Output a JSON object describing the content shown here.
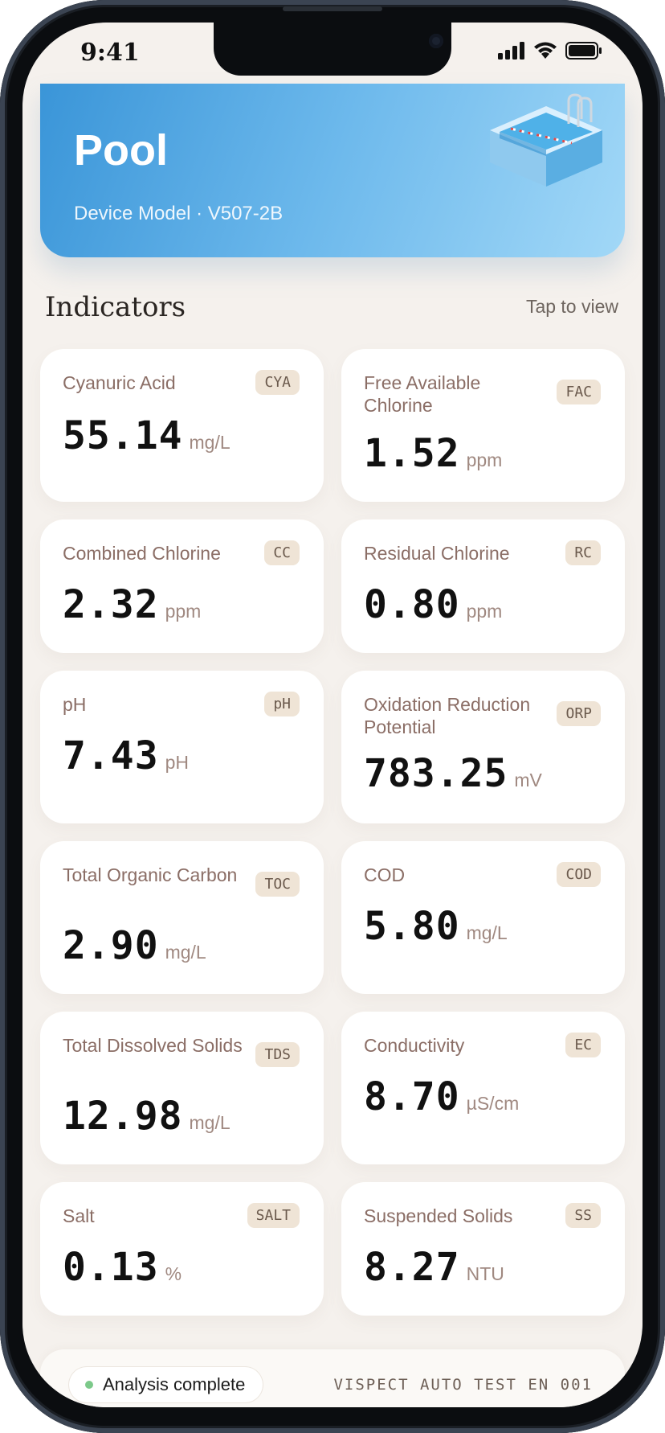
{
  "status_bar": {
    "time": "9:41"
  },
  "header": {
    "title": "Pool",
    "subtitle": "Device Model · V507-2B"
  },
  "section": {
    "title": "Indicators",
    "link": "Tap to view"
  },
  "indicators": [
    {
      "label": "Cyanuric Acid",
      "code": "CYA",
      "value": "55.14",
      "unit": "mg/L"
    },
    {
      "label": "Free Available Chlorine",
      "code": "FAC",
      "value": "1.52",
      "unit": "ppm"
    },
    {
      "label": "Combined Chlorine",
      "code": "CC",
      "value": "2.32",
      "unit": "ppm"
    },
    {
      "label": "Residual Chlorine",
      "code": "RC",
      "value": "0.80",
      "unit": "ppm"
    },
    {
      "label": "pH",
      "code": "pH",
      "value": "7.43",
      "unit": "pH"
    },
    {
      "label": "Oxidation Reduction Potential",
      "code": "ORP",
      "value": "783.25",
      "unit": "mV"
    },
    {
      "label": "Total Organic Carbon",
      "code": "TOC",
      "value": "2.90",
      "unit": "mg/L"
    },
    {
      "label": "COD",
      "code": "COD",
      "value": "5.80",
      "unit": "mg/L"
    },
    {
      "label": "Total Dissolved Solids",
      "code": "TDS",
      "value": "12.98",
      "unit": "mg/L"
    },
    {
      "label": "Conductivity",
      "code": "EC",
      "value": "8.70",
      "unit": "µS/cm"
    },
    {
      "label": "Salt",
      "code": "SALT",
      "value": "0.13",
      "unit": "%"
    },
    {
      "label": "Suspended Solids",
      "code": "SS",
      "value": "8.27",
      "unit": "NTU"
    }
  ],
  "footer": {
    "status": "Analysis complete",
    "status_color": "#7cc98a",
    "test_id": "VISPECT AUTO TEST EN 001"
  },
  "icons": [
    "signal-icon",
    "wifi-icon",
    "battery-icon",
    "pool-illustration"
  ]
}
